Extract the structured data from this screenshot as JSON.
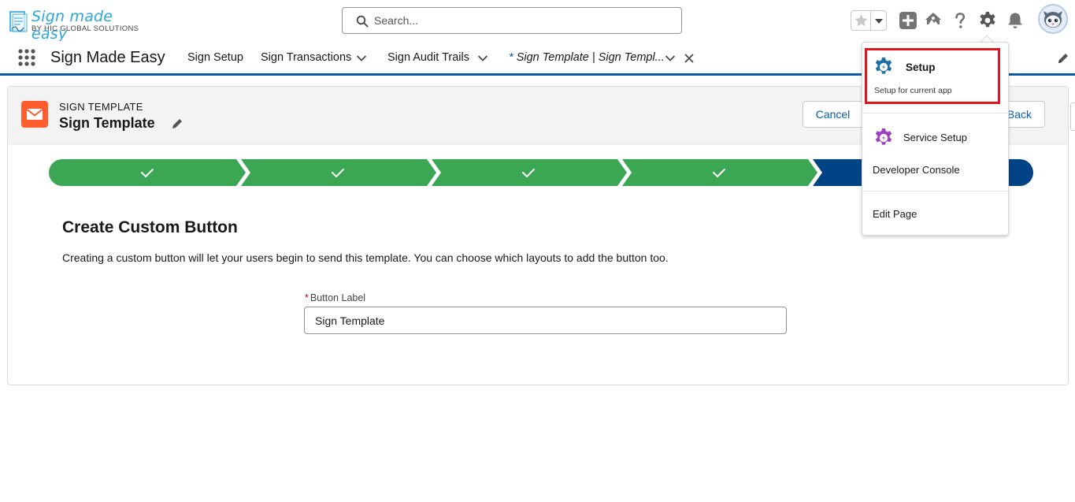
{
  "logo": {
    "title": "Sign made easy",
    "subtitle": "BY HIC GLOBAL SOLUTIONS"
  },
  "search": {
    "placeholder": "Search..."
  },
  "app": {
    "name": "Sign Made Easy"
  },
  "nav": {
    "items": [
      {
        "label": "Sign Setup"
      },
      {
        "label": "Sign Transactions"
      },
      {
        "label": "Sign Audit Trails"
      }
    ],
    "active_tab": {
      "marker": "*",
      "label": "Sign Template | Sign Templ..."
    }
  },
  "page_header": {
    "object_label": "SIGN TEMPLATE",
    "title": "Sign Template",
    "cancel_label": "Cancel",
    "back_label": "Back"
  },
  "path": {
    "completed_steps": 4,
    "colors": {
      "complete": "#3ba755",
      "current": "#014486"
    }
  },
  "form": {
    "section_title": "Create Custom Button",
    "description": "Creating a custom button will let your users begin to send this template. You can choose which layouts to add the button too.",
    "field_required_marker": "*",
    "field_label": "Button Label",
    "field_value": "Sign Template"
  },
  "setup_menu": {
    "setup_title": "Setup",
    "setup_subtitle": "Setup for current app",
    "service_setup": "Service Setup",
    "developer_console": "Developer Console",
    "edit_page": "Edit Page"
  },
  "colors": {
    "brand": "#0b5cab",
    "highlight": "#e3141c",
    "object_icon": "#ff5d2d"
  }
}
